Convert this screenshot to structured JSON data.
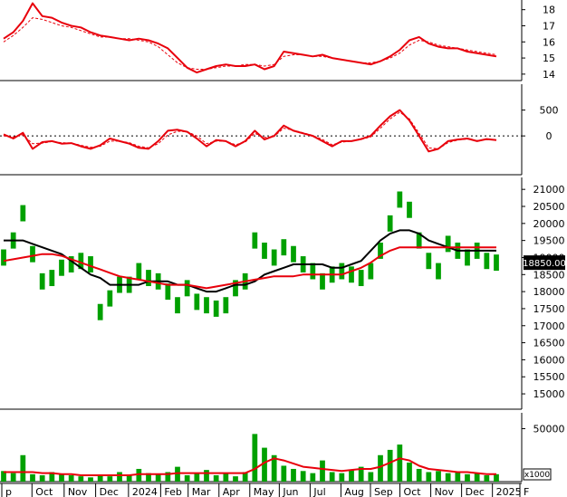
{
  "chart_data": [
    {
      "type": "line",
      "panel": "indicator-1",
      "yticks": [
        "18",
        "17",
        "16",
        "15",
        "14"
      ],
      "ylim": [
        13.6,
        18.6
      ],
      "series": [
        {
          "role": "main",
          "color": "#e8000b",
          "style": "solid",
          "values": [
            16.2,
            16.6,
            17.3,
            18.4,
            17.6,
            17.5,
            17.2,
            17.0,
            16.9,
            16.6,
            16.4,
            16.3,
            16.2,
            16.1,
            16.2,
            16.1,
            15.9,
            15.6,
            15.0,
            14.4,
            14.1,
            14.3,
            14.5,
            14.6,
            14.5,
            14.5,
            14.6,
            14.3,
            14.5,
            15.4,
            15.3,
            15.2,
            15.1,
            15.2,
            15.0,
            14.9,
            14.8,
            14.7,
            14.6,
            14.8,
            15.1,
            15.5,
            16.1,
            16.3,
            15.9,
            15.7,
            15.6,
            15.6,
            15.4,
            15.3,
            15.2,
            15.1
          ]
        },
        {
          "role": "signal",
          "color": "#e8000b",
          "style": "dashed",
          "values": [
            16.0,
            16.4,
            16.9,
            17.5,
            17.4,
            17.2,
            17.0,
            16.9,
            16.7,
            16.5,
            16.3,
            16.3,
            16.2,
            16.2,
            16.1,
            16.0,
            15.7,
            15.2,
            14.7,
            14.4,
            14.3,
            14.3,
            14.4,
            14.5,
            14.5,
            14.6,
            14.6,
            14.5,
            14.6,
            15.1,
            15.2,
            15.2,
            15.1,
            15.1,
            15.0,
            14.9,
            14.8,
            14.7,
            14.7,
            14.8,
            15.0,
            15.3,
            15.8,
            16.1,
            16.0,
            15.8,
            15.7,
            15.6,
            15.5,
            15.4,
            15.3,
            15.2
          ]
        }
      ]
    },
    {
      "type": "line",
      "panel": "indicator-2",
      "yticks": [
        "500",
        "0"
      ],
      "ylim": [
        -750,
        1000
      ],
      "reference_line": 0,
      "series": [
        {
          "role": "main",
          "color": "#e8000b",
          "style": "solid",
          "values": [
            30,
            -50,
            60,
            -250,
            -120,
            -100,
            -150,
            -140,
            -200,
            -250,
            -180,
            -50,
            -100,
            -150,
            -230,
            -250,
            -100,
            100,
            120,
            80,
            -50,
            -200,
            -80,
            -100,
            -200,
            -100,
            100,
            -70,
            0,
            200,
            100,
            50,
            0,
            -100,
            -200,
            -100,
            -100,
            -60,
            0,
            200,
            380,
            500,
            300,
            0,
            -300,
            -250,
            -100,
            -70,
            -50,
            -100,
            -60,
            -80
          ]
        },
        {
          "role": "signal",
          "color": "#e8000b",
          "style": "dashed",
          "values": [
            0,
            -20,
            20,
            -150,
            -140,
            -110,
            -130,
            -140,
            -180,
            -220,
            -200,
            -100,
            -100,
            -130,
            -200,
            -230,
            -150,
            20,
            90,
            80,
            0,
            -150,
            -100,
            -100,
            -170,
            -120,
            50,
            -30,
            -10,
            150,
            110,
            60,
            10,
            -70,
            -170,
            -120,
            -100,
            -70,
            -20,
            150,
            330,
            460,
            330,
            50,
            -230,
            -250,
            -130,
            -80,
            -60,
            -90,
            -70,
            -80
          ]
        }
      ]
    },
    {
      "type": "line",
      "panel": "price",
      "yticks": [
        "21000",
        "20500",
        "20000",
        "19500",
        "19000",
        "18500",
        "18000",
        "17500",
        "17000",
        "16500",
        "16000",
        "15500",
        "15000"
      ],
      "ylim": [
        14550,
        21350
      ],
      "last_price_label": "18850.00",
      "series": [
        {
          "role": "price",
          "color": "#00a000",
          "style": "bars",
          "values": [
            19000,
            19500,
            20300,
            19100,
            18300,
            18400,
            18700,
            18800,
            18900,
            18800,
            17400,
            17800,
            18200,
            18200,
            18600,
            18400,
            18300,
            18000,
            17600,
            18100,
            17700,
            17600,
            17500,
            17600,
            18100,
            18300,
            19500,
            19200,
            19000,
            19300,
            19100,
            18800,
            18600,
            18300,
            18500,
            18600,
            18500,
            18400,
            18600,
            19200,
            20000,
            20700,
            20400,
            19500,
            18900,
            18600,
            19400,
            19200,
            19000,
            19200,
            18900,
            18850
          ]
        },
        {
          "role": "ma-black",
          "color": "#000000",
          "style": "solid",
          "values": [
            19500,
            19500,
            19500,
            19400,
            19300,
            19200,
            19100,
            18900,
            18700,
            18500,
            18400,
            18200,
            18200,
            18200,
            18200,
            18300,
            18300,
            18300,
            18200,
            18200,
            18100,
            18000,
            18000,
            18100,
            18200,
            18200,
            18300,
            18500,
            18600,
            18700,
            18800,
            18800,
            18800,
            18800,
            18700,
            18700,
            18800,
            18900,
            19200,
            19500,
            19700,
            19800,
            19800,
            19700,
            19500,
            19400,
            19300,
            19200,
            19200,
            19200,
            19200,
            19200
          ]
        },
        {
          "role": "ma-red",
          "color": "#e8000b",
          "style": "solid",
          "values": [
            18900,
            18950,
            19000,
            19050,
            19100,
            19100,
            19050,
            18950,
            18850,
            18750,
            18650,
            18550,
            18450,
            18400,
            18350,
            18300,
            18250,
            18200,
            18200,
            18200,
            18150,
            18100,
            18150,
            18200,
            18250,
            18300,
            18350,
            18400,
            18450,
            18450,
            18450,
            18500,
            18500,
            18500,
            18500,
            18500,
            18600,
            18700,
            18850,
            19050,
            19200,
            19300,
            19300,
            19300,
            19300,
            19300,
            19300,
            19300,
            19300,
            19300,
            19300,
            19300
          ]
        }
      ]
    },
    {
      "type": "bar",
      "panel": "volume",
      "yticks": [
        "50000"
      ],
      "ylim": [
        0,
        65000
      ],
      "unit_label": "x1000",
      "series": [
        {
          "role": "volume",
          "color": "#00a000",
          "style": "bars",
          "values": [
            10000,
            8000,
            25000,
            7000,
            6000,
            9000,
            7000,
            6000,
            5000,
            4000,
            6000,
            5000,
            9000,
            6000,
            12000,
            8000,
            7000,
            9000,
            14000,
            6000,
            8000,
            11000,
            6000,
            8000,
            5000,
            9000,
            45000,
            32000,
            25000,
            15000,
            12000,
            10000,
            8000,
            20000,
            9000,
            8000,
            11000,
            14000,
            9000,
            25000,
            30000,
            35000,
            18000,
            12000,
            9000,
            10000,
            8000,
            9000,
            7000,
            8000,
            6000,
            7000
          ]
        },
        {
          "role": "volume-ma",
          "color": "#e8000b",
          "style": "solid",
          "values": [
            9000,
            9000,
            9000,
            9000,
            8000,
            8000,
            7000,
            7000,
            6000,
            6000,
            6000,
            6000,
            6000,
            6000,
            7000,
            7000,
            7000,
            7000,
            8000,
            8000,
            8000,
            8000,
            8000,
            8000,
            8000,
            8000,
            12000,
            18000,
            22000,
            20000,
            17000,
            14000,
            13000,
            12000,
            11000,
            10000,
            11000,
            12000,
            12000,
            14000,
            18000,
            22000,
            20000,
            15000,
            12000,
            11000,
            10000,
            9000,
            9000,
            8000,
            7000,
            7000
          ]
        }
      ]
    }
  ],
  "x_axis": {
    "labels": [
      "p",
      "Oct",
      "Nov",
      "Dec",
      "2024",
      "Feb",
      "Mar",
      "Apr",
      "May",
      "Jun",
      "Jul",
      "Aug",
      "Sep",
      "Oct",
      "Nov",
      "Dec",
      "2025",
      "F"
    ],
    "label_index": [
      0,
      4.5,
      9.3,
      14.0,
      18.9,
      23.7,
      27.8,
      32.4,
      37.0,
      41.4,
      46.0,
      50.6,
      55.0,
      59.4,
      64.0,
      68.6,
      73.2,
      77.3
    ]
  }
}
